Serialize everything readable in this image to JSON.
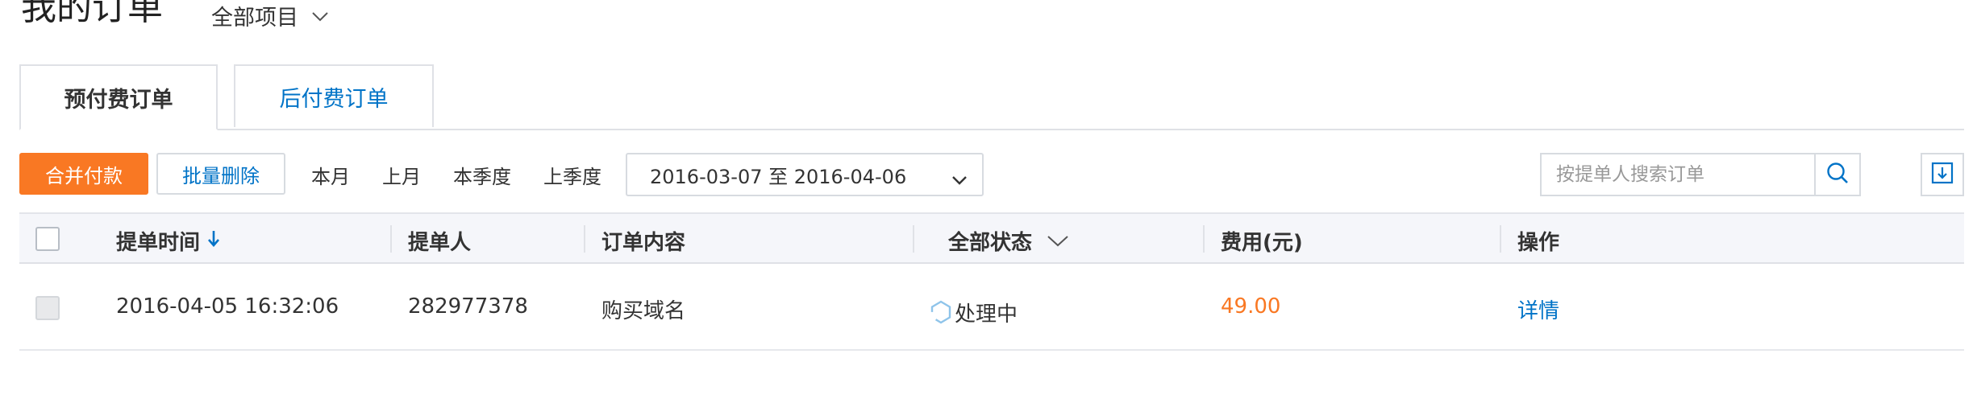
{
  "page_title": "我的订单",
  "project_filter": {
    "label": "全部项目"
  },
  "tabs": [
    {
      "label": "预付费订单",
      "active": true
    },
    {
      "label": "后付费订单",
      "active": false
    }
  ],
  "toolbar": {
    "merge_pay_label": "合并付款",
    "batch_delete_label": "批量删除",
    "quick_ranges": [
      "本月",
      "上月",
      "本季度",
      "上季度"
    ],
    "date_range": "2016-03-07 至 2016-04-06",
    "search_placeholder": "按提单人搜索订单"
  },
  "table": {
    "columns": {
      "time": "提单时间",
      "submitter": "提单人",
      "content": "订单内容",
      "status": "全部状态",
      "fee": "费用(元)",
      "action": "操作"
    },
    "rows": [
      {
        "time": "2016-04-05 16:32:06",
        "submitter": "282977378",
        "content": "购买域名",
        "status": "处理中",
        "fee": "49.00",
        "action": "详情"
      }
    ]
  },
  "colors": {
    "accent_orange": "#f97823",
    "link_blue": "#0073c7",
    "border": "#d7dbe0",
    "header_bg": "#f5f6fa"
  },
  "icons": {
    "project_dropdown": "chevron-down-icon",
    "sort": "arrow-down-icon",
    "status_filter": "chevron-down-icon",
    "date_dropdown": "chevron-down-icon",
    "search": "search-icon",
    "download": "download-icon",
    "status_processing": "hexagon-spinner-icon"
  }
}
